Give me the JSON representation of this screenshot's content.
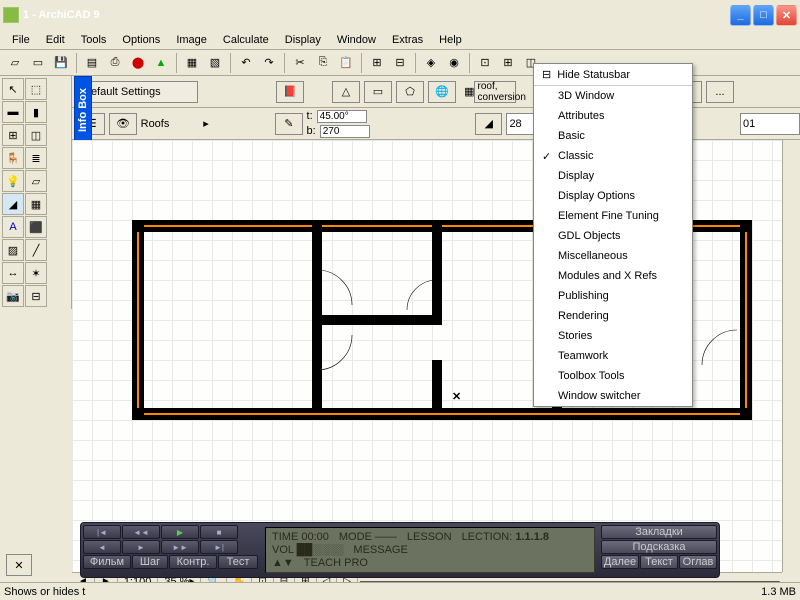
{
  "title": "1 - ArchiCAD 9",
  "menus": [
    "File",
    "Edit",
    "Tools",
    "Options",
    "Image",
    "Calculate",
    "Display",
    "Window",
    "Extras",
    "Help"
  ],
  "settings": {
    "default": "Default Settings",
    "layer": "Roofs",
    "angle_t": "45.00°",
    "angle_b": "270",
    "roof_label": "roof, conversion",
    "num1": "28",
    "num2": "01",
    "dots": "..."
  },
  "context": {
    "header": "Hide Statusbar",
    "items": [
      "3D Window",
      "Attributes",
      "Basic",
      "Classic",
      "Display",
      "Display Options",
      "Element Fine Tuning",
      "GDL Objects",
      "Miscellaneous",
      "Modules and X Refs",
      "Publishing",
      "Rendering",
      "Stories",
      "Teamwork",
      "Toolbox Tools",
      "Window switcher"
    ],
    "checked": "Classic"
  },
  "scrollbar": {
    "ratio": "1:100",
    "zoom": "35 %"
  },
  "status": {
    "left": "Shows or hides t",
    "mem": "1.3 MB"
  },
  "player": {
    "btns_bottom": [
      "Фильм",
      "Шаг",
      "Контр.",
      "Тест"
    ],
    "lcd_time": "TIME 00:00",
    "lcd_mode": "MODE ——",
    "lcd_lesson": "LESSON",
    "lcd_lection": "LECTION:",
    "lcd_lection_num": "1.1.1.8",
    "lcd_msg": "MESSAGE",
    "lcd_teach": "TEACH PRO",
    "right1": "Закладки",
    "right2": "Подсказка",
    "right_row": [
      "Далее",
      "Текст",
      "Оглав"
    ]
  },
  "infobox": "Info Box"
}
